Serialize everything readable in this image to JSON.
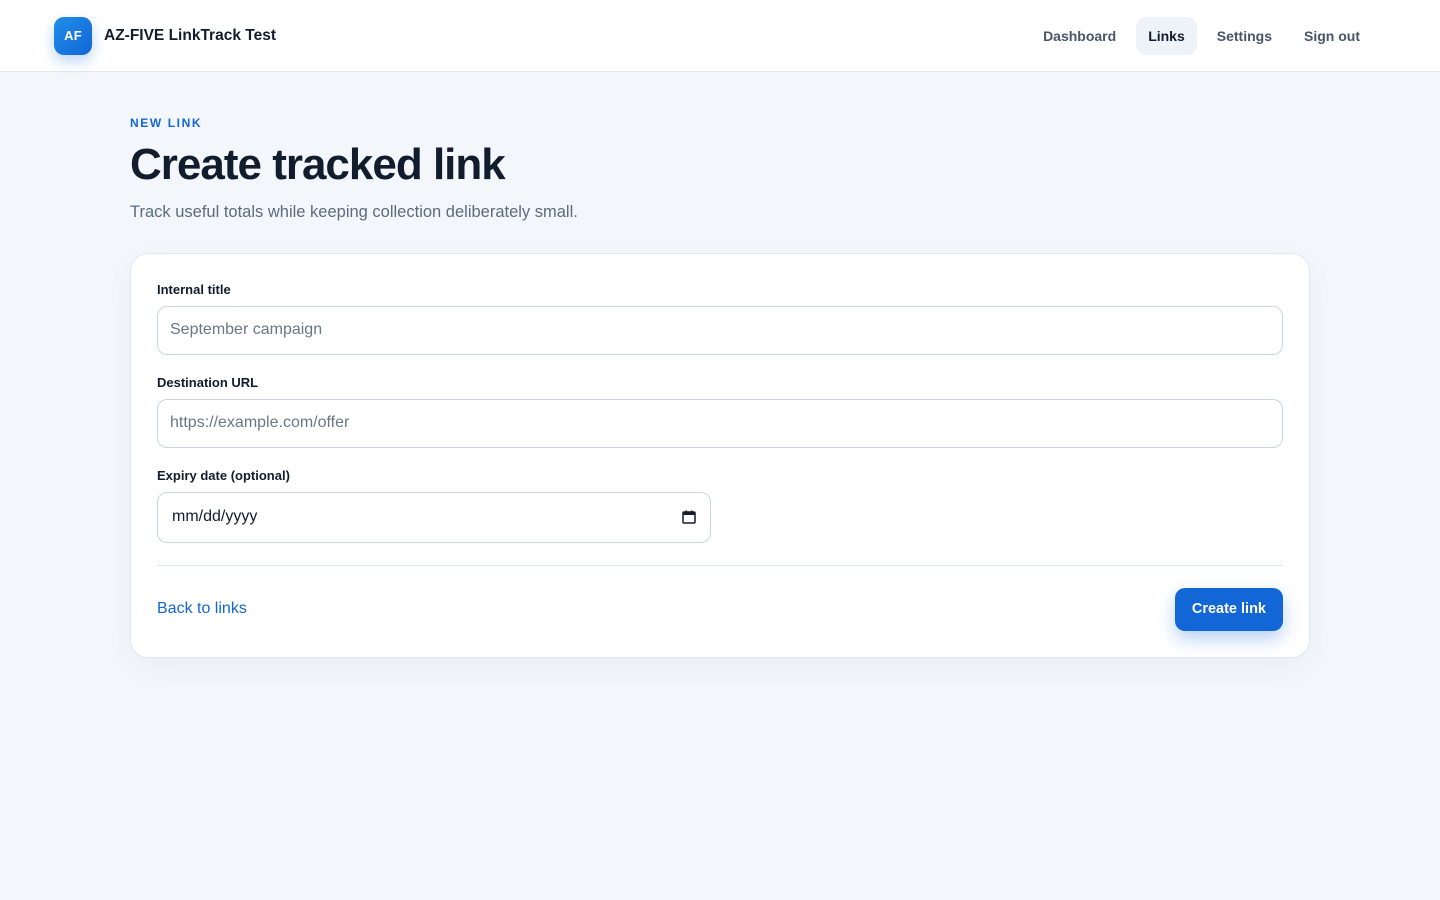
{
  "header": {
    "logo_text": "AF",
    "app_name": "AZ-FIVE LinkTrack Test",
    "nav": [
      {
        "label": "Dashboard",
        "active": false
      },
      {
        "label": "Links",
        "active": true
      },
      {
        "label": "Settings",
        "active": false
      },
      {
        "label": "Sign out",
        "active": false
      }
    ]
  },
  "page": {
    "eyebrow": "NEW LINK",
    "title": "Create tracked link",
    "subtitle": "Track useful totals while keeping collection deliberately small."
  },
  "form": {
    "title_field": {
      "label": "Internal title",
      "placeholder": "September campaign",
      "value": ""
    },
    "url_field": {
      "label": "Destination URL",
      "placeholder": "https://example.com/offer",
      "value": ""
    },
    "expiry_field": {
      "label": "Expiry date (optional)",
      "placeholder": "mm/dd/yyyy",
      "icon": "calendar-icon"
    },
    "back_link": "Back to links",
    "submit_label": "Create link"
  },
  "colors": {
    "accent": "#1366d6",
    "background": "#f3f6fa",
    "text": "#111c2d",
    "muted": "#5b6b80"
  }
}
